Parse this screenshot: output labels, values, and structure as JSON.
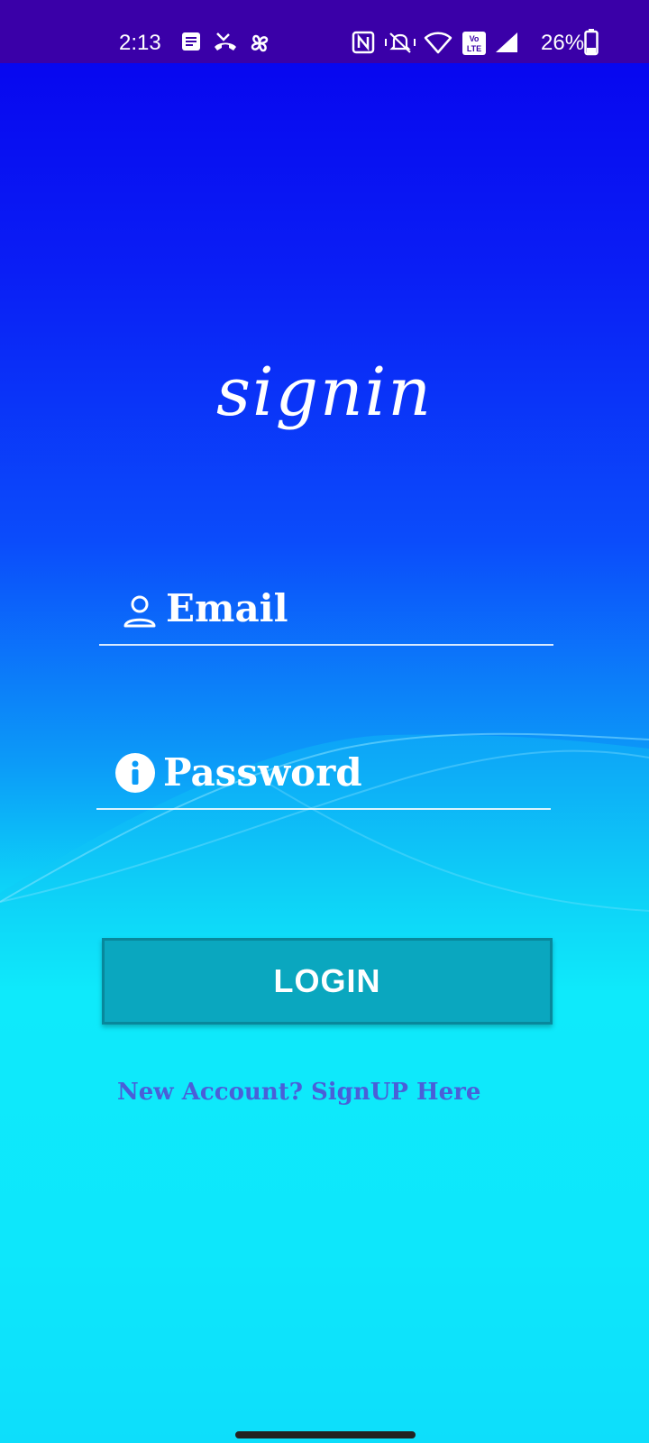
{
  "status_bar": {
    "time": "2:13",
    "battery": "26%",
    "left_icons": [
      "notes-icon",
      "missed-call-icon",
      "pinwheel-icon"
    ],
    "right_icons": [
      "nfc-icon",
      "vibrate-icon",
      "wifi-icon",
      "volte-icon",
      "signal-icon",
      "battery-icon"
    ],
    "background": "#3a00a8"
  },
  "screen": {
    "title": "signin",
    "gradient_top": "#0600ee",
    "gradient_bottom": "#0cf7fd"
  },
  "form": {
    "email": {
      "placeholder": "Email",
      "value": "",
      "icon": "person-icon"
    },
    "password": {
      "placeholder": "Password",
      "value": "",
      "icon": "info-icon"
    },
    "login_label": "LOGIN",
    "login_color": "#0aa7bf",
    "signup_link": "New Account? SignUP Here",
    "signup_color": "#4a5fd8"
  }
}
